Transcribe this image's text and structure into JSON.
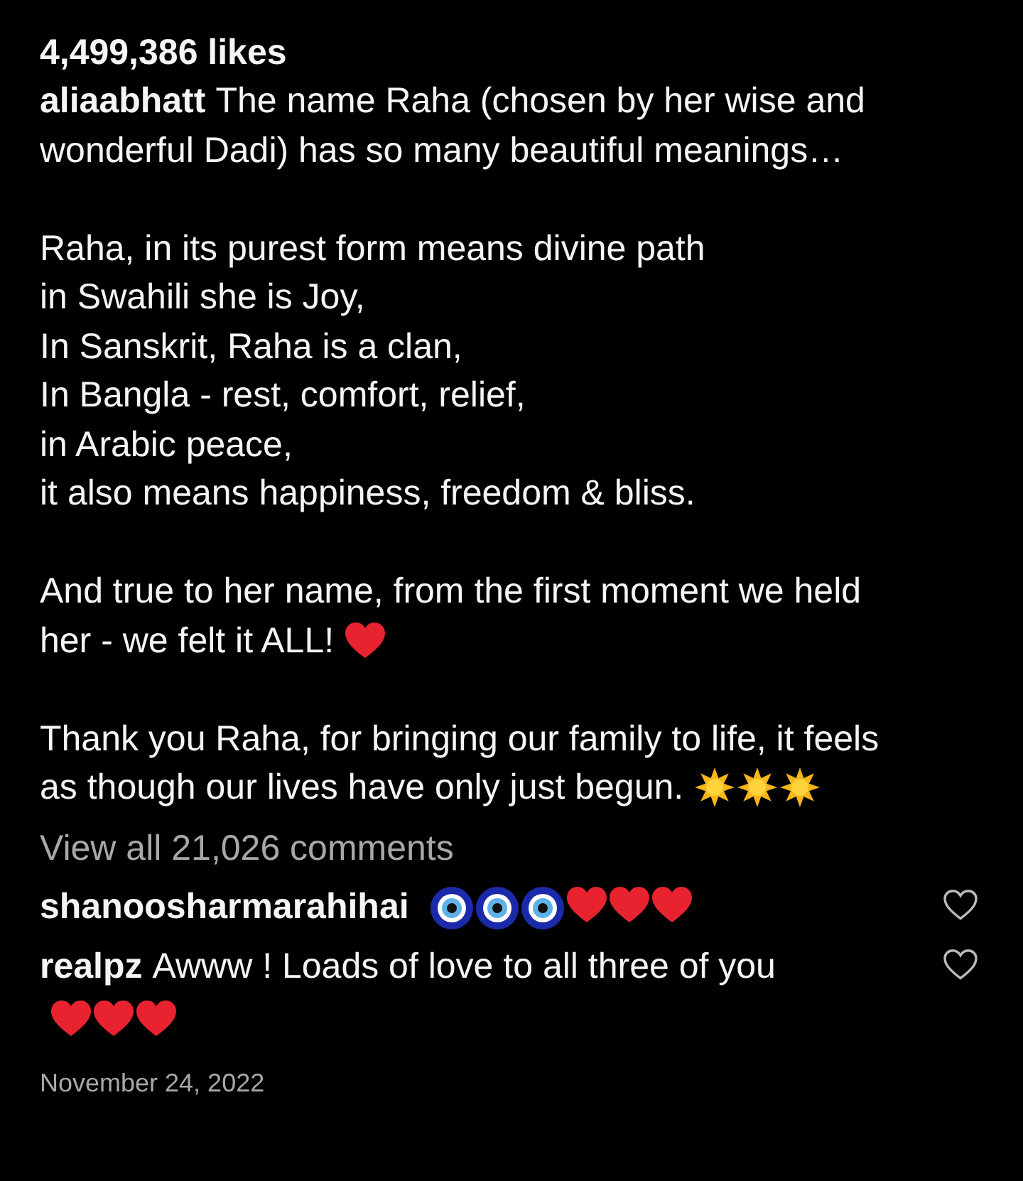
{
  "likes": "4,499,386 likes",
  "caption": {
    "username": "aliaabhatt",
    "paragraphs": [
      {
        "lines": [
          {
            "text": "The name Raha (chosen by her wise and"
          },
          {
            "text": "wonderful Dadi) has so many beautiful meanings…"
          }
        ]
      },
      {
        "lines": [
          {
            "text": "Raha, in its purest form means divine path"
          },
          {
            "text": "in Swahili she is Joy,"
          },
          {
            "text": "In Sanskrit, Raha is a clan,"
          },
          {
            "text": "In Bangla - rest, comfort, relief,"
          },
          {
            "text": "in Arabic peace,"
          },
          {
            "text": "it also means happiness, freedom & bliss."
          }
        ]
      },
      {
        "lines": [
          {
            "text": "And true to her name, from the first moment we held"
          },
          {
            "text": "her - we felt it ALL!",
            "emojis": [
              {
                "kind": "heart"
              }
            ]
          }
        ]
      },
      {
        "lines": [
          {
            "text": "Thank you Raha, for bringing our family to life, it feels"
          },
          {
            "text": "as though our lives have only just begun.",
            "emojis": [
              {
                "kind": "sun"
              },
              {
                "kind": "sun"
              },
              {
                "kind": "sun"
              }
            ]
          }
        ]
      }
    ]
  },
  "view_all_comments": "View all 21,026 comments",
  "comments": [
    {
      "username": "shanoosharmarahihai",
      "emojis": [
        {
          "kind": "nazar"
        },
        {
          "kind": "nazar"
        },
        {
          "kind": "nazar"
        },
        {
          "kind": "heart"
        },
        {
          "kind": "heart"
        },
        {
          "kind": "heart"
        }
      ],
      "liked": false
    },
    {
      "username": "realpz",
      "text": "Awww ! Loads of love to all three of you",
      "emojis": [
        {
          "kind": "heart"
        },
        {
          "kind": "heart"
        },
        {
          "kind": "heart"
        }
      ],
      "liked": false
    }
  ],
  "date": "November 24, 2022"
}
